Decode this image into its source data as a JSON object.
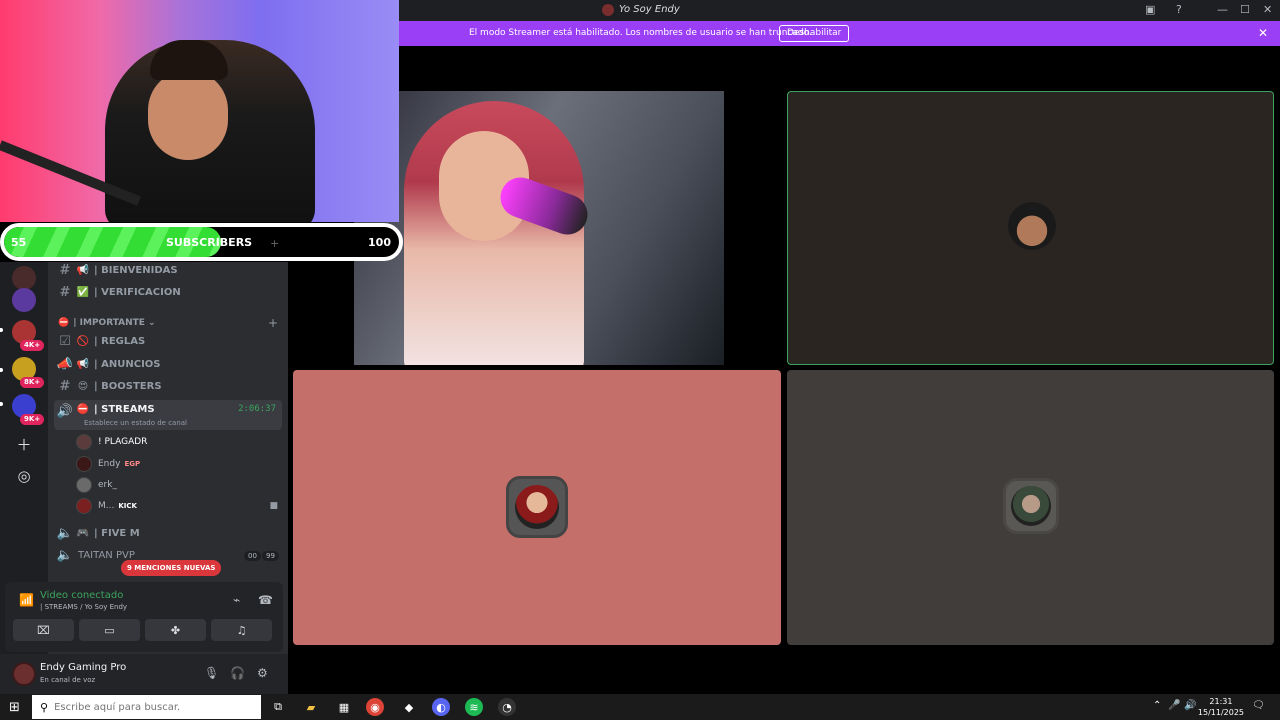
{
  "window": {
    "title": "Yo Soy Endy"
  },
  "banner": {
    "text": "El modo Streamer está habilitado. Los nombres de usuario se han truncado.",
    "button": "Deshabilitar"
  },
  "overlay": {
    "min": "55",
    "label": "SUBSCRIBERS",
    "max": "100",
    "plus": "+",
    "progress_fraction": 0.55
  },
  "servers": {
    "badges": [
      "4K+",
      "8K+",
      "9K+"
    ]
  },
  "channels": {
    "top": [
      {
        "emoji": "📢",
        "name": "| BIENVENIDAS",
        "glyph": "#"
      },
      {
        "emoji": "✅",
        "name": "| VERIFICACION",
        "glyph": "#"
      }
    ],
    "category": "| IMPORTANTE",
    "list": [
      {
        "emoji": "🚫",
        "name": "| REGLAS",
        "glyph": "☑"
      },
      {
        "emoji": "📢",
        "name": "| ANUNCIOS",
        "glyph": "📣"
      },
      {
        "emoji": "😍",
        "name": "| BOOSTERS",
        "glyph": "#"
      }
    ],
    "active": {
      "emoji": "⛔",
      "name": "| STREAMS",
      "timer": "2:06:37",
      "status": "Establece un estado de canal"
    },
    "voice_users": [
      {
        "name": "! PLAGADR",
        "tag": ""
      },
      {
        "name": "Endy",
        "tag": "EGP"
      },
      {
        "name": "erk_",
        "tag": ""
      },
      {
        "name": "M...",
        "tag": "KICK"
      }
    ],
    "after": [
      {
        "name": "| FIVE M"
      },
      {
        "name": "TAITAN PVP"
      }
    ],
    "counts": [
      "00",
      "99"
    ],
    "mentions": "9 MENCIONES NUEVAS"
  },
  "voice_panel": {
    "status": "Video conectado",
    "location": "| STREAMS / Yo Soy Endy"
  },
  "user": {
    "name": "Endy Gaming Pro",
    "status": "En canal de voz"
  },
  "taskbar": {
    "search_placeholder": "Escribe aquí para buscar.",
    "time": "21:31",
    "date": "15/11/2025"
  },
  "colors": {
    "banner": "#9b3ff7",
    "speaking_border": "#3ba55d",
    "progress": "#33dd33",
    "tile3": "#c46f6a",
    "tile4": "#403d3a",
    "mentions": "#da373c"
  }
}
